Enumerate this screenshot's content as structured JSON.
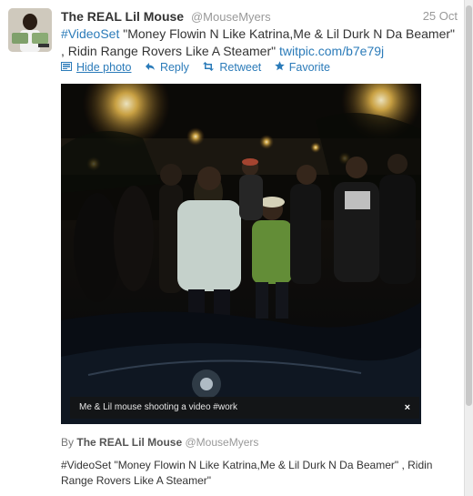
{
  "tweet": {
    "fullname": "The REAL Lil Mouse",
    "username": "@MouseMyers",
    "timestamp": "25 Oct",
    "text": {
      "hashtag": "#VideoSet",
      "body": " \"Money Flowin N Like Katrina,Me & Lil Durk N Da Beamer\" , Ridin Range Rovers Like A Steamer\" ",
      "link": "twitpic.com/b7e79j"
    },
    "actions": {
      "hide_photo": "Hide photo",
      "reply": "Reply",
      "retweet": "Retweet",
      "favorite": "Favorite"
    }
  },
  "photo": {
    "caption": "Me & Lil mouse shooting a video #work",
    "close": "×"
  },
  "byline": {
    "by": "By",
    "fullname": "The REAL Lil Mouse",
    "username": "@MouseMyers"
  },
  "description": "#VideoSet \"Money Flowin N Like Katrina,Me & Lil Durk N Da Beamer\" , Ridin Range Rovers Like A Steamer\"",
  "icons": {
    "photo": "photo-icon",
    "reply": "reply-icon",
    "retweet": "retweet-icon",
    "favorite": "star-icon"
  },
  "colors": {
    "link": "#2b7bb9",
    "muted": "#999999",
    "text": "#333333"
  }
}
